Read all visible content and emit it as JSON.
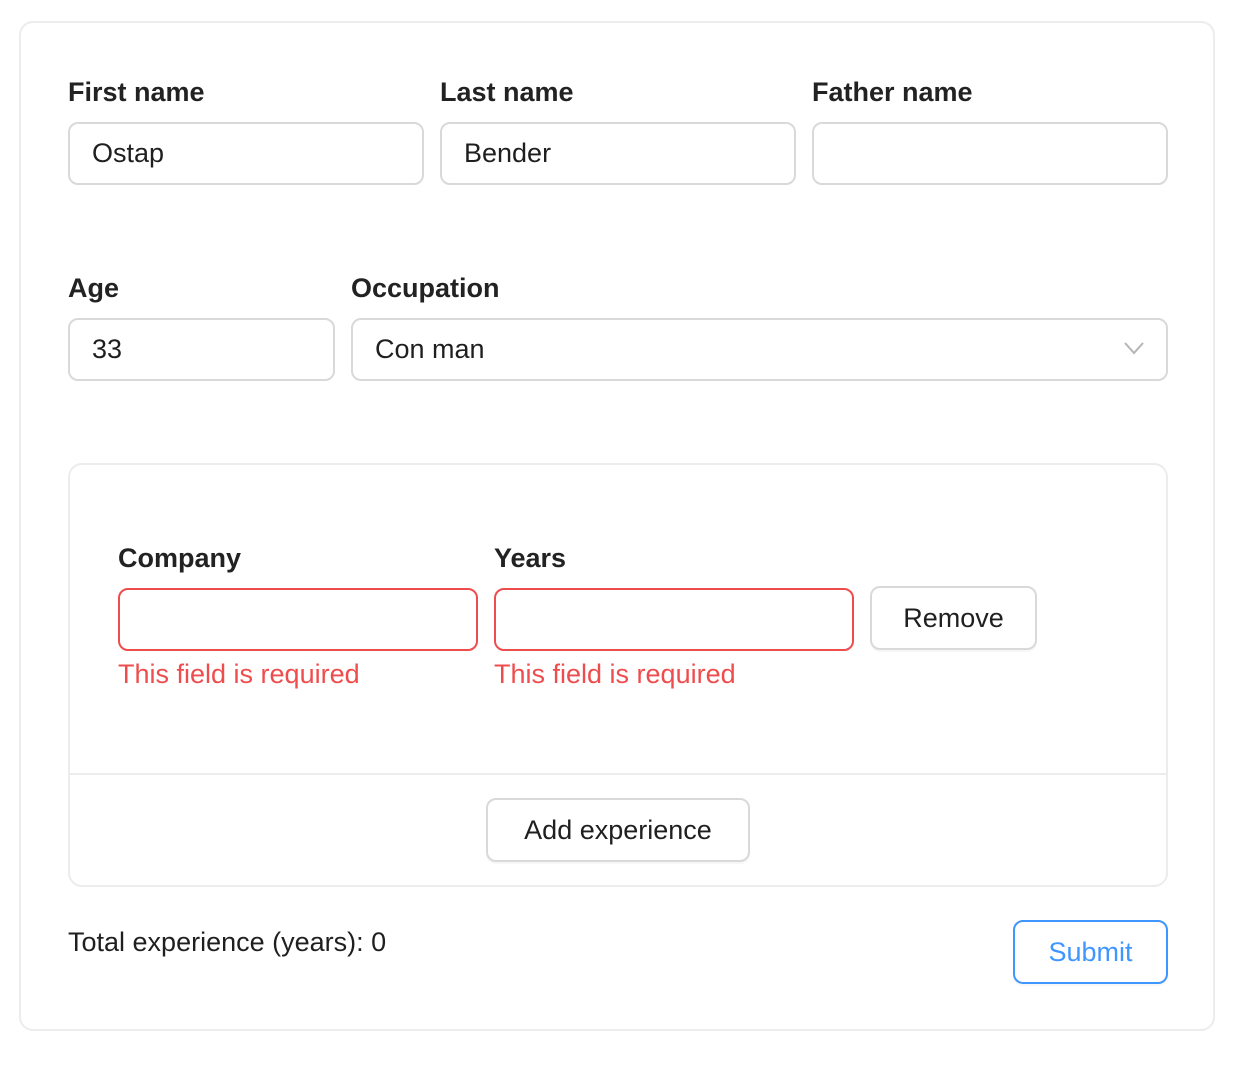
{
  "form": {
    "first_name": {
      "label": "First name",
      "value": "Ostap",
      "placeholder": ""
    },
    "last_name": {
      "label": "Last name",
      "value": "Bender",
      "placeholder": ""
    },
    "father_name": {
      "label": "Father name",
      "value": "",
      "placeholder": ""
    },
    "age": {
      "label": "Age",
      "value": "33"
    },
    "occupation": {
      "label": "Occupation",
      "selected": "Con man"
    }
  },
  "experience": {
    "items": [
      {
        "company": {
          "label": "Company",
          "value": "",
          "error": "This field is required"
        },
        "years": {
          "label": "Years",
          "value": "",
          "error": "This field is required"
        },
        "remove_label": "Remove"
      }
    ],
    "add_label": "Add experience"
  },
  "footer": {
    "total_label": "Total experience (years): 0",
    "submit_label": "Submit"
  },
  "colors": {
    "error": "#ef4d4d",
    "primary": "#4096ff",
    "border": "#d9d9d9",
    "card_border": "#ececec"
  },
  "icons": {
    "occupation_dropdown": "chevron-down-icon"
  }
}
